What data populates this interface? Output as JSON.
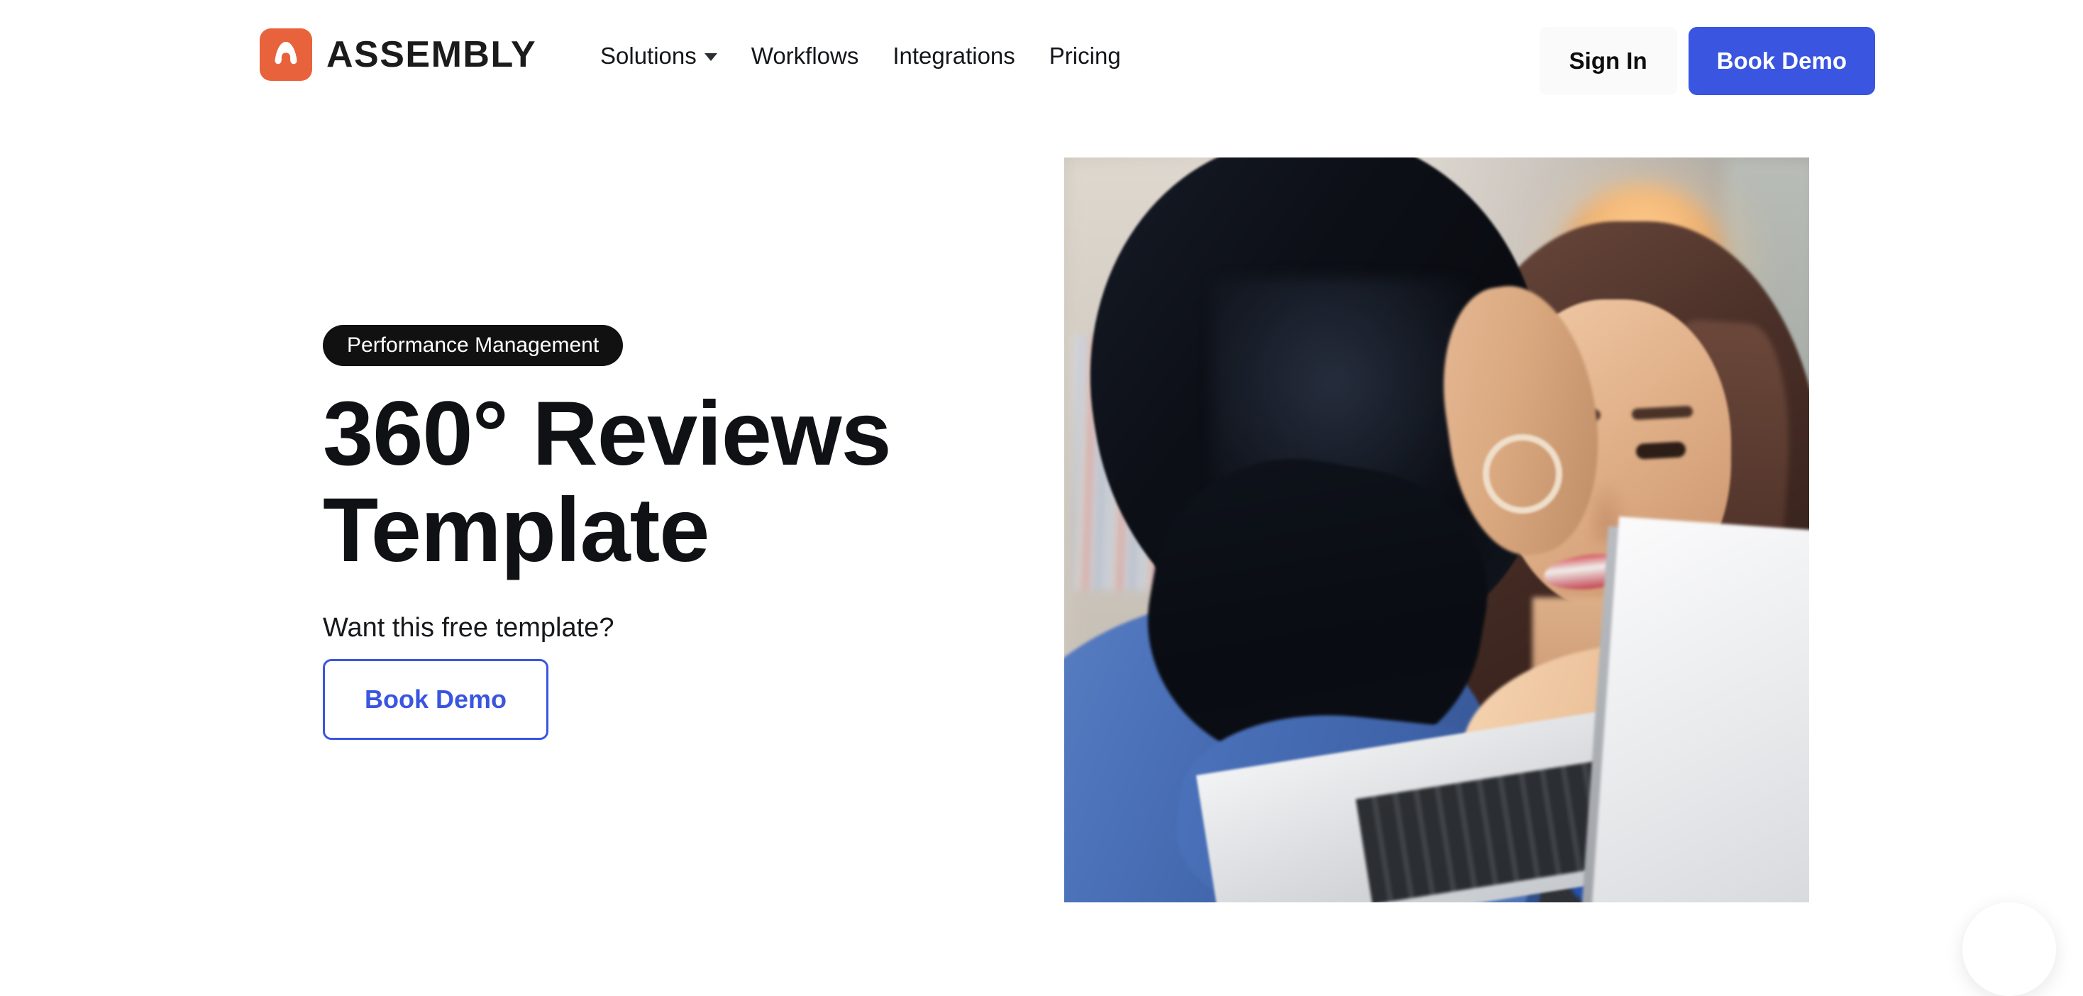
{
  "brand": {
    "name": "ASSEMBLY",
    "logo_icon": "assembly-a-logo-icon",
    "logo_color": "#e8633c"
  },
  "header": {
    "nav": [
      {
        "label": "Solutions",
        "has_dropdown": true,
        "icon": "chevron-down-icon"
      },
      {
        "label": "Workflows",
        "has_dropdown": false
      },
      {
        "label": "Integrations",
        "has_dropdown": false
      },
      {
        "label": "Pricing",
        "has_dropdown": false
      }
    ],
    "sign_in_label": "Sign In",
    "book_demo_label": "Book Demo",
    "primary_color": "#3a55e0"
  },
  "hero": {
    "eyebrow": "Performance Management",
    "title": "360° Reviews Template",
    "subtitle": "Want this free template?",
    "cta_label": "Book Demo",
    "image_alt": "Two colleagues talking at a desk with a laptop"
  },
  "chat": {
    "icon": "chat-bubble-icon"
  }
}
